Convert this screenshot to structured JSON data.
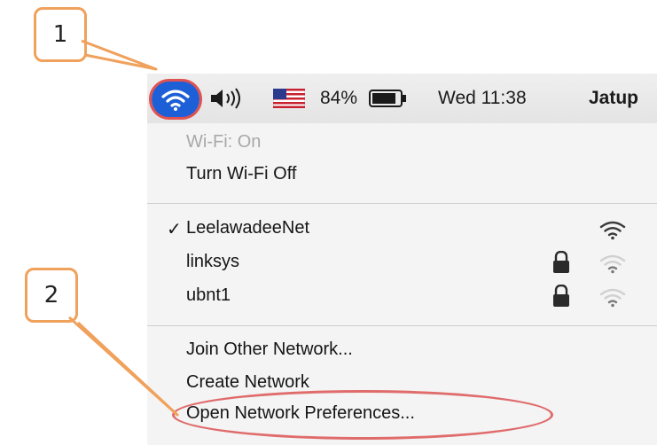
{
  "callouts": {
    "one": "1",
    "two": "2"
  },
  "menubar": {
    "battery_percent": "84%",
    "clock": "Wed 11:38",
    "user": "Jatup"
  },
  "menu": {
    "status": "Wi-Fi: On",
    "toggle": "Turn Wi-Fi Off",
    "networks": [
      {
        "name": "LeelawadeeNet",
        "connected": true,
        "secured": false,
        "check": "✓"
      },
      {
        "name": "linksys",
        "connected": false,
        "secured": true
      },
      {
        "name": "ubnt1",
        "connected": false,
        "secured": true
      }
    ],
    "join_other": "Join Other Network...",
    "create": "Create Network",
    "preferences": "Open Network Preferences..."
  },
  "colors": {
    "callout_border": "#f0a15c",
    "highlight_red": "#e05252",
    "wifi_blue": "#1c5fd6"
  },
  "icons": [
    "wifi-icon",
    "volume-icon",
    "us-flag-icon",
    "battery-icon",
    "lock-icon",
    "wifi-signal-icon",
    "checkmark-icon"
  ]
}
